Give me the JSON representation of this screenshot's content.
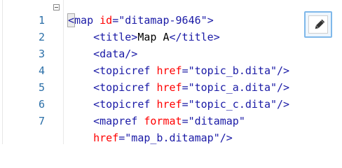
{
  "editor": {
    "lines": [
      {
        "n": "1",
        "seg": [
          {
            "c": "tag",
            "t": "<"
          },
          {
            "c": "tag",
            "t": "map "
          },
          {
            "c": "attr",
            "t": "id"
          },
          {
            "c": "tag",
            "t": "="
          },
          {
            "c": "str",
            "t": "\"ditamap-9646\""
          },
          {
            "c": "tag",
            "t": ">"
          }
        ]
      },
      {
        "n": "2",
        "seg": [
          {
            "c": "tag",
            "t": "    <title>"
          },
          {
            "c": "txt",
            "t": "Map A"
          },
          {
            "c": "tag",
            "t": "</title>"
          }
        ]
      },
      {
        "n": "3",
        "seg": [
          {
            "c": "tag",
            "t": "    <data/>"
          }
        ]
      },
      {
        "n": "4",
        "seg": [
          {
            "c": "tag",
            "t": "    <topicref "
          },
          {
            "c": "attr",
            "t": "href"
          },
          {
            "c": "tag",
            "t": "="
          },
          {
            "c": "str",
            "t": "\"topic_b.dita\""
          },
          {
            "c": "tag",
            "t": "/>"
          }
        ]
      },
      {
        "n": "5",
        "seg": [
          {
            "c": "tag",
            "t": "    <topicref "
          },
          {
            "c": "attr",
            "t": "href"
          },
          {
            "c": "tag",
            "t": "="
          },
          {
            "c": "str",
            "t": "\"topic_a.dita\""
          },
          {
            "c": "tag",
            "t": "/>"
          }
        ]
      },
      {
        "n": "6",
        "seg": [
          {
            "c": "tag",
            "t": "    <topicref "
          },
          {
            "c": "attr",
            "t": "href"
          },
          {
            "c": "tag",
            "t": "="
          },
          {
            "c": "str",
            "t": "\"topic_c.dita\""
          },
          {
            "c": "tag",
            "t": "/>"
          }
        ]
      },
      {
        "n": "7",
        "seg": [
          {
            "c": "tag",
            "t": "    <mapref "
          },
          {
            "c": "attr",
            "t": "format"
          },
          {
            "c": "tag",
            "t": "="
          },
          {
            "c": "str",
            "t": "\"ditamap\""
          }
        ]
      },
      {
        "n": "",
        "seg": [
          {
            "c": "attr",
            "t": "    href"
          },
          {
            "c": "tag",
            "t": "="
          },
          {
            "c": "str",
            "t": "\"map_b.ditamap\""
          },
          {
            "c": "tag",
            "t": "/>"
          }
        ]
      }
    ]
  },
  "toolbar": {
    "edit_icon": "pencil-icon",
    "fold_icon": "collapse-minus-icon"
  },
  "colors": {
    "tag": "#1a1aa6",
    "attr": "#ff0000",
    "line_number": "#2b6fa8",
    "button_border": "#7fb8ea"
  }
}
